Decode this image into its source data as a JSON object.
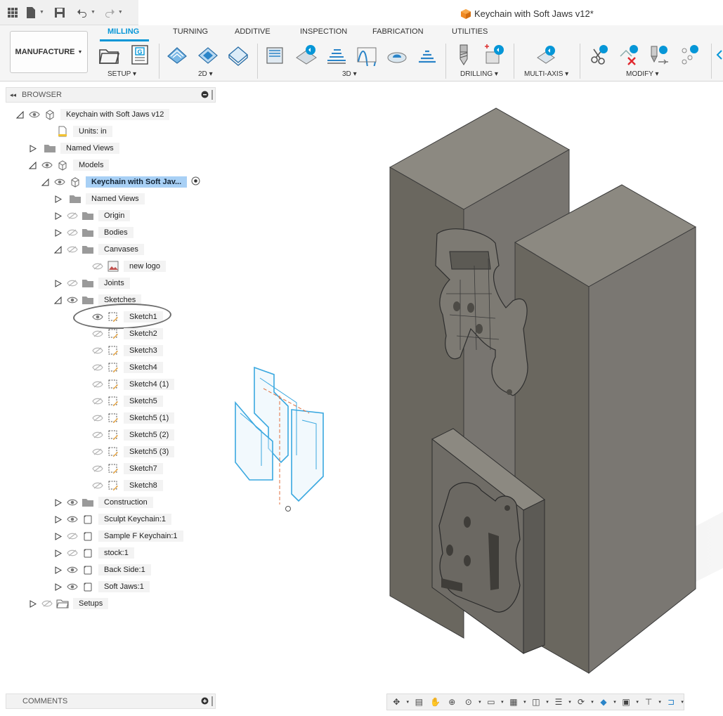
{
  "window": {
    "title": "Keychain with Soft Jaws v12*"
  },
  "quick_access": {
    "icons": [
      "grid-menu-icon",
      "file-icon",
      "save-icon",
      "undo-icon",
      "redo-icon"
    ]
  },
  "ribbon": {
    "workspace": "MANUFACTURE",
    "tabs": [
      {
        "label": "MILLING",
        "active": true
      },
      {
        "label": "TURNING",
        "active": false
      },
      {
        "label": "ADDITIVE",
        "active": false
      },
      {
        "label": "INSPECTION",
        "active": false
      },
      {
        "label": "FABRICATION",
        "active": false
      },
      {
        "label": "UTILITIES",
        "active": false
      }
    ],
    "groups": [
      {
        "label": "SETUP"
      },
      {
        "label": "2D"
      },
      {
        "label": "3D"
      },
      {
        "label": "DRILLING"
      },
      {
        "label": "MULTI-AXIS"
      },
      {
        "label": "MODIFY"
      }
    ],
    "accent_color": "#0696d7"
  },
  "browser": {
    "title": "BROWSER",
    "rows": [
      {
        "label": "Keychain with Soft Jaws v12",
        "expanded": true
      },
      {
        "label": "Units: in"
      },
      {
        "label": "Named Views",
        "expanded": false
      },
      {
        "label": "Models",
        "expanded": true
      },
      {
        "label": "Keychain with Soft Jav...",
        "expanded": true,
        "selected": true
      },
      {
        "label": "Named Views",
        "expanded": false
      },
      {
        "label": "Origin",
        "expanded": false
      },
      {
        "label": "Bodies",
        "expanded": false
      },
      {
        "label": "Canvases",
        "expanded": true
      },
      {
        "label": "new logo"
      },
      {
        "label": "Joints",
        "expanded": false
      },
      {
        "label": "Sketches",
        "expanded": true
      },
      {
        "label": "Sketch1",
        "visible": true
      },
      {
        "label": "Sketch2"
      },
      {
        "label": "Sketch3"
      },
      {
        "label": "Sketch4"
      },
      {
        "label": "Sketch4 (1)"
      },
      {
        "label": "Sketch5"
      },
      {
        "label": "Sketch5 (1)"
      },
      {
        "label": "Sketch5 (2)"
      },
      {
        "label": "Sketch5 (3)"
      },
      {
        "label": "Sketch7"
      },
      {
        "label": "Sketch8"
      },
      {
        "label": "Construction",
        "expanded": false
      },
      {
        "label": "Sculpt Keychain:1",
        "expanded": false
      },
      {
        "label": "Sample F Keychain:1",
        "expanded": false
      },
      {
        "label": "stock:1",
        "expanded": false
      },
      {
        "label": "Back Side:1",
        "expanded": false
      },
      {
        "label": "Soft Jaws:1",
        "expanded": false
      },
      {
        "label": "Setups",
        "expanded": false
      }
    ]
  },
  "comments": {
    "title": "COMMENTS"
  },
  "viewport": {
    "model_color": "#6e6b64"
  },
  "nav_bar": {
    "icons": [
      "orbit-icon",
      "look-at-icon",
      "pan-icon",
      "zoom-icon",
      "fit-icon",
      "display-settings-icon",
      "grid-icon",
      "viewports-icon",
      "env-icon",
      "orbit-type-icon",
      "effects-icon",
      "section-icon",
      "tool-icon",
      "show-icon"
    ]
  }
}
